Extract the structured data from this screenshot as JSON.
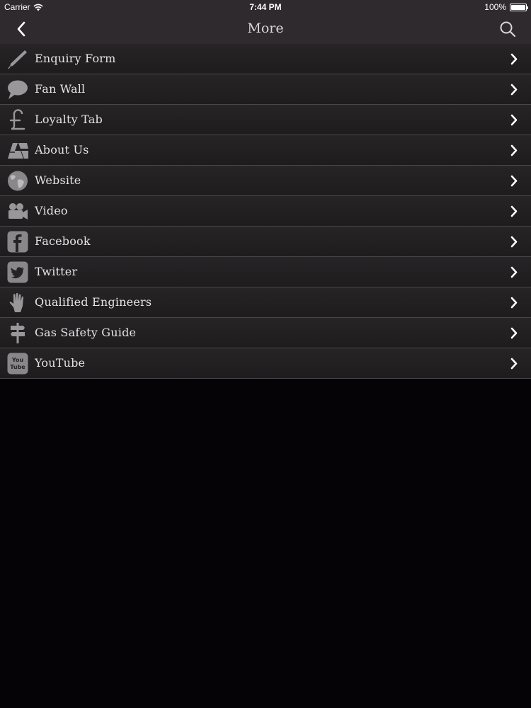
{
  "status_bar": {
    "carrier": "Carrier",
    "time": "7:44 PM",
    "battery_text": "100%",
    "battery_level": 1.0
  },
  "nav": {
    "title": "More",
    "back_icon": "chevron-left-icon",
    "search_icon": "search-icon"
  },
  "menu": {
    "items": [
      {
        "label": "Enquiry Form",
        "icon": "pencil-icon"
      },
      {
        "label": "Fan Wall",
        "icon": "speech-bubble-icon"
      },
      {
        "label": "Loyalty Tab",
        "icon": "pound-sign-icon"
      },
      {
        "label": "About Us",
        "icon": "map-icon"
      },
      {
        "label": "Website",
        "icon": "globe-icon"
      },
      {
        "label": "Video",
        "icon": "video-camera-icon"
      },
      {
        "label": "Facebook",
        "icon": "facebook-icon"
      },
      {
        "label": "Twitter",
        "icon": "twitter-icon"
      },
      {
        "label": "Qualified Engineers",
        "icon": "hand-icon"
      },
      {
        "label": "Gas Safety Guide",
        "icon": "signpost-icon"
      },
      {
        "label": "YouTube",
        "icon": "youtube-icon",
        "icon_text": [
          "You",
          "Tube"
        ]
      }
    ]
  },
  "colors": {
    "nav_background": "#2f2a2e",
    "row_background": "#242123",
    "row_divider": "#4a474a",
    "page_background": "#050305",
    "text": "#e6e4e6",
    "icon": "#9a979a"
  }
}
